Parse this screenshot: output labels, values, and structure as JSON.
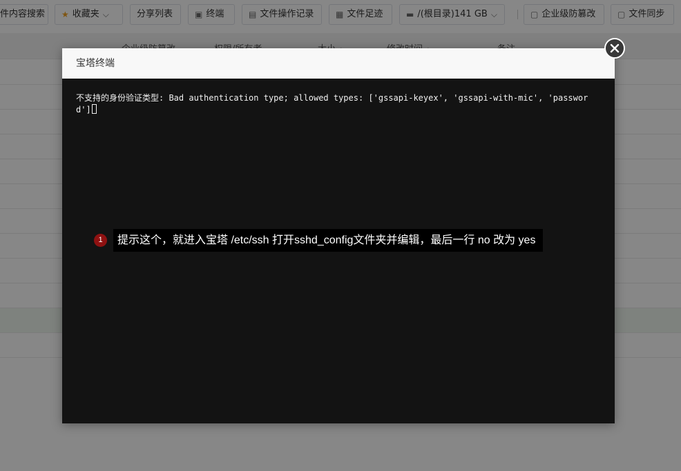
{
  "toolbar": {
    "buttons": [
      {
        "label": "件内容搜索"
      },
      {
        "label": "收藏夹"
      },
      {
        "label": "分享列表"
      },
      {
        "label": "终端"
      },
      {
        "label": "文件操作记录"
      },
      {
        "label": "文件足迹"
      },
      {
        "label": "/(根目录)141 GB"
      },
      {
        "label": "企业级防篡改"
      },
      {
        "label": "文件同步"
      }
    ]
  },
  "table": {
    "headers": [
      "企业级防篡改",
      "权限/所有者",
      "大小",
      "修改时间",
      "备注"
    ]
  },
  "modal": {
    "title": "宝塔终端",
    "terminal_output": "不支持的身份验证类型: Bad authentication type; allowed types: ['gssapi-keyex', 'gssapi-with-mic', 'password']"
  },
  "annotation": {
    "number": "1",
    "text": "提示这个，就进入宝塔 /etc/ssh  打开sshd_config文件夹并编辑，最后一行 no 改为 yes"
  },
  "colors": {
    "terminal_bg": "#131313",
    "annotation_badge": "#8f1111"
  }
}
